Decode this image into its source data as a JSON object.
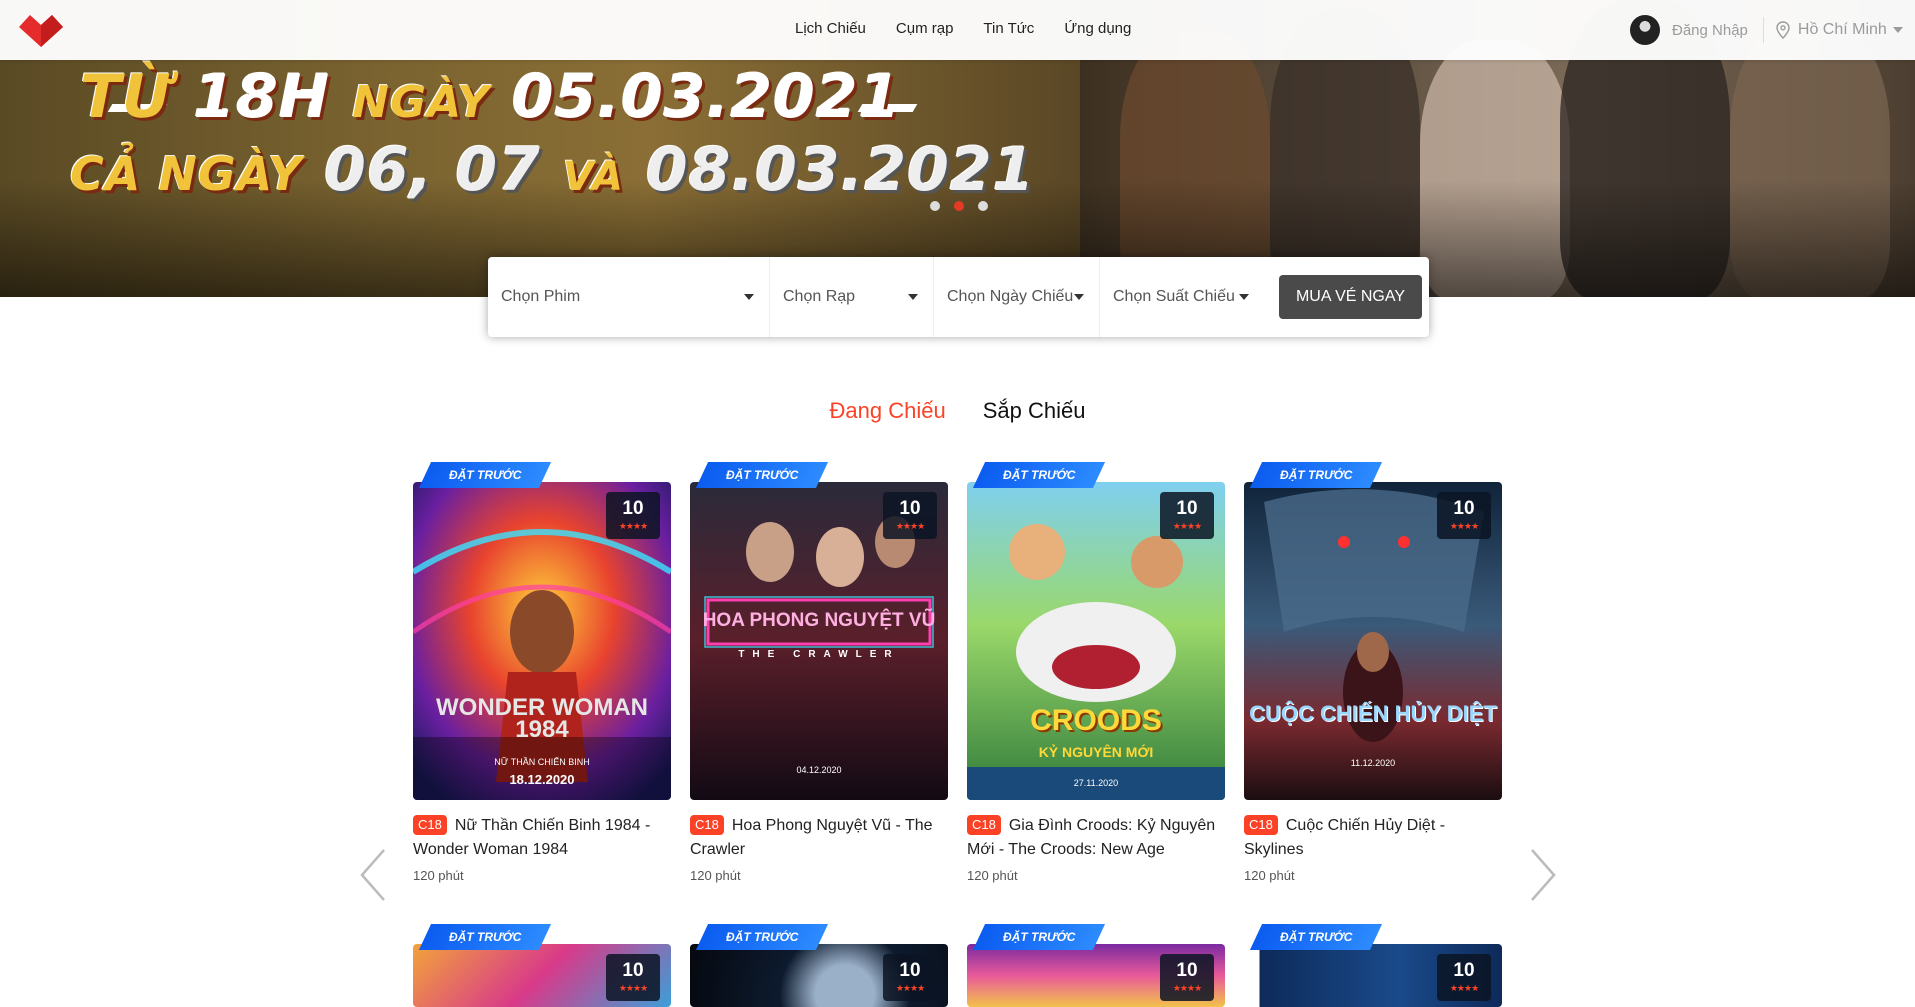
{
  "header": {
    "nav": [
      "Lịch Chiếu",
      "Cụm rạp",
      "Tin Tức",
      "Ứng dụng"
    ],
    "login_label": "Đăng Nhập",
    "location": "Hồ Chí Minh"
  },
  "banner": {
    "line1_a": "TỪ",
    "line1_b": "18H",
    "line1_c": "NGÀY",
    "line1_d": "05.03.2021",
    "line2_a": "CẢ NGÀY",
    "line2_b": "06, 07",
    "line2_c": "VÀ",
    "line2_d": "08.03.2021",
    "active_slide": 2,
    "slides": 3
  },
  "search": {
    "movie": "Chọn Phim",
    "cinema": "Chọn Rạp",
    "date": "Chọn Ngày Chiếu",
    "time": "Chọn Suất Chiếu",
    "buy": "MUA VÉ NGAY"
  },
  "tabs": {
    "now_showing": "Đang Chiếu",
    "coming_soon": "Sắp Chiếu"
  },
  "movies": [
    {
      "ribbon": "ĐẶT TRƯỚC",
      "rating": "10",
      "stars": "★★★★",
      "age": "C18",
      "title": "Nữ Thần Chiến Binh 1984 - Wonder Woman 1984",
      "duration": "120 phút",
      "poster_text": "WONDER WOMAN 1984",
      "poster_sub": "NỮ THẦN CHIẾN BINH",
      "poster_date": "18.12.2020"
    },
    {
      "ribbon": "ĐẶT TRƯỚC",
      "rating": "10",
      "stars": "★★★★",
      "age": "C18",
      "title": "Hoa Phong Nguyệt Vũ - The Crawler",
      "duration": "120 phút",
      "poster_text": "HOA PHONG NGUYỆT VŨ",
      "poster_sub": "THE CRAWLER",
      "poster_date": "04.12.2020"
    },
    {
      "ribbon": "ĐẶT TRƯỚC",
      "rating": "10",
      "stars": "★★★★",
      "age": "C18",
      "title": "Gia Đình Croods: Kỷ Nguyên Mới - The Croods: New Age",
      "duration": "120 phút",
      "poster_text": "CROODS",
      "poster_sub": "KỶ NGUYÊN MỚI",
      "poster_date": "27.11.2020"
    },
    {
      "ribbon": "ĐẶT TRƯỚC",
      "rating": "10",
      "stars": "★★★★",
      "age": "C18",
      "title": "Cuộc Chiến Hủy Diệt - Skylines",
      "duration": "120 phút",
      "poster_text": "CUỘC CHIẾN HỦY DIỆT",
      "poster_sub": "",
      "poster_date": "11.12.2020"
    }
  ],
  "movies_row2": [
    {
      "ribbon": "ĐẶT TRƯỚC",
      "rating": "10",
      "stars": "★★★★"
    },
    {
      "ribbon": "ĐẶT TRƯỚC",
      "rating": "10",
      "stars": "★★★★"
    },
    {
      "ribbon": "ĐẶT TRƯỚC",
      "rating": "10",
      "stars": "★★★★"
    },
    {
      "ribbon": "ĐẶT TRƯỚC",
      "rating": "10",
      "stars": "★★★★"
    }
  ],
  "colors": {
    "accent": "#fb4226",
    "button": "#4a4a4a",
    "ribbon": "#1565f0"
  }
}
